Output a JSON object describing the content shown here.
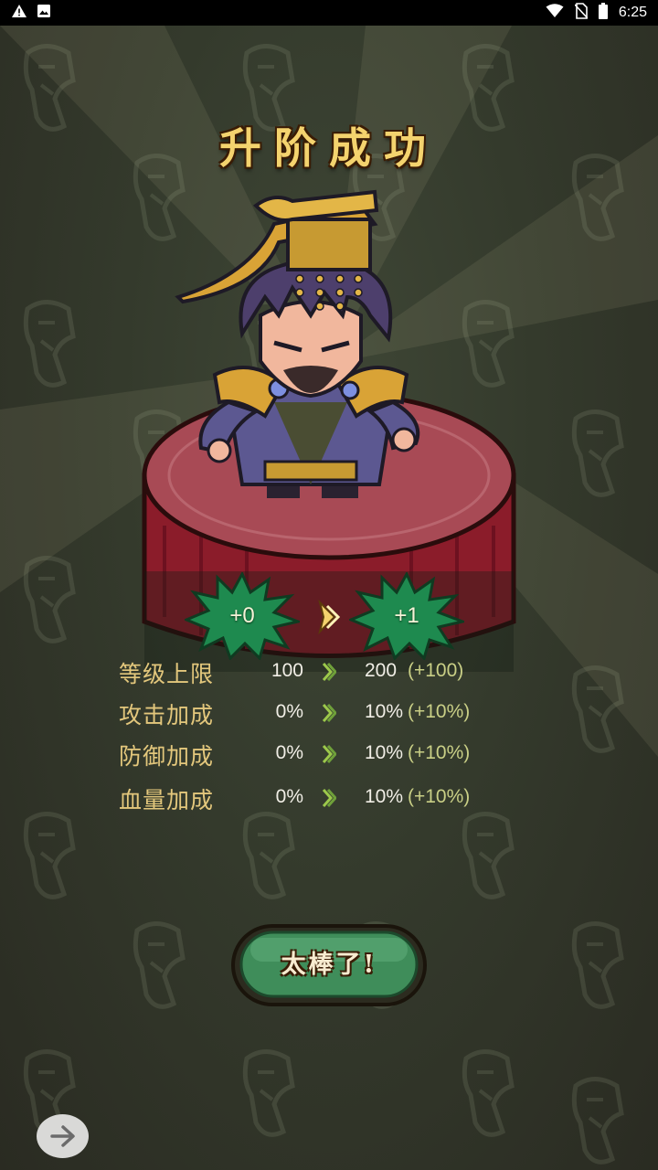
{
  "status_bar": {
    "time": "6:25",
    "left_icons": [
      "warning-icon",
      "image-icon"
    ],
    "right_icons": [
      "wifi-icon",
      "no-sim-icon",
      "battery-icon"
    ]
  },
  "title": "升阶成功",
  "stage": {
    "from": "+0",
    "to": "+1"
  },
  "stats": [
    {
      "label": "等级上限",
      "from": "100",
      "to": "200",
      "delta": "(+100)"
    },
    {
      "label": "攻击加成",
      "from": "0%",
      "to": "10%",
      "delta": "(+10%)"
    },
    {
      "label": "防御加成",
      "from": "0%",
      "to": "10%",
      "delta": "(+10%)"
    },
    {
      "label": "血量加成",
      "from": "0%",
      "to": "10%",
      "delta": "(+10%)"
    }
  ],
  "confirm_button": "太棒了!",
  "colors": {
    "title": "#f4d36e",
    "stat_label": "#e3c77c",
    "stat_delta": "#c9cf86",
    "badge_green": "#1e8a4f",
    "pedestal_red": "#8b1c2a",
    "button_green": "#3f8d5a"
  }
}
